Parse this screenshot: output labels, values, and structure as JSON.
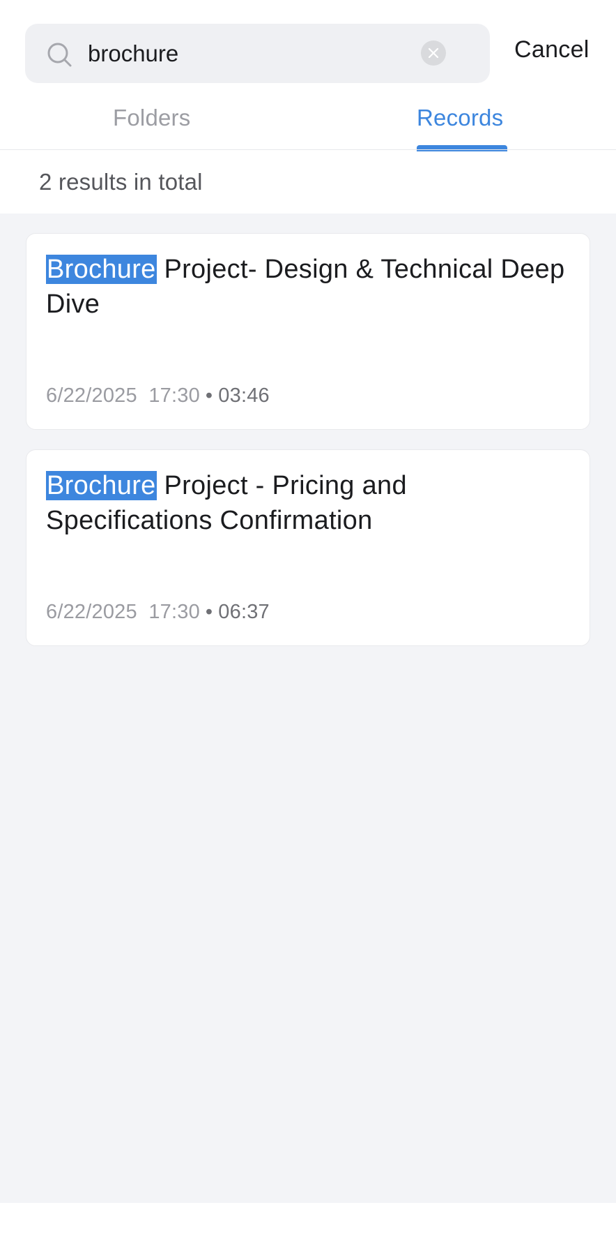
{
  "search": {
    "value": "brochure",
    "cancel_label": "Cancel"
  },
  "tabs": [
    {
      "label": "Folders",
      "active": false
    },
    {
      "label": "Records",
      "active": true
    }
  ],
  "results": {
    "count_text": "2 results in total",
    "items": [
      {
        "highlight": "Brochure",
        "title_rest": " Project- Design & Technical Deep Dive",
        "date": "6/22/2025",
        "time": "17:30",
        "duration": "03:46"
      },
      {
        "highlight": "Brochure",
        "title_rest": " Project - Pricing and Specifications Confirmation",
        "date": "6/22/2025",
        "time": "17:30",
        "duration": "06:37"
      }
    ]
  },
  "colors": {
    "accent": "#3d86de",
    "background": "#f3f4f7",
    "card": "#ffffff"
  }
}
